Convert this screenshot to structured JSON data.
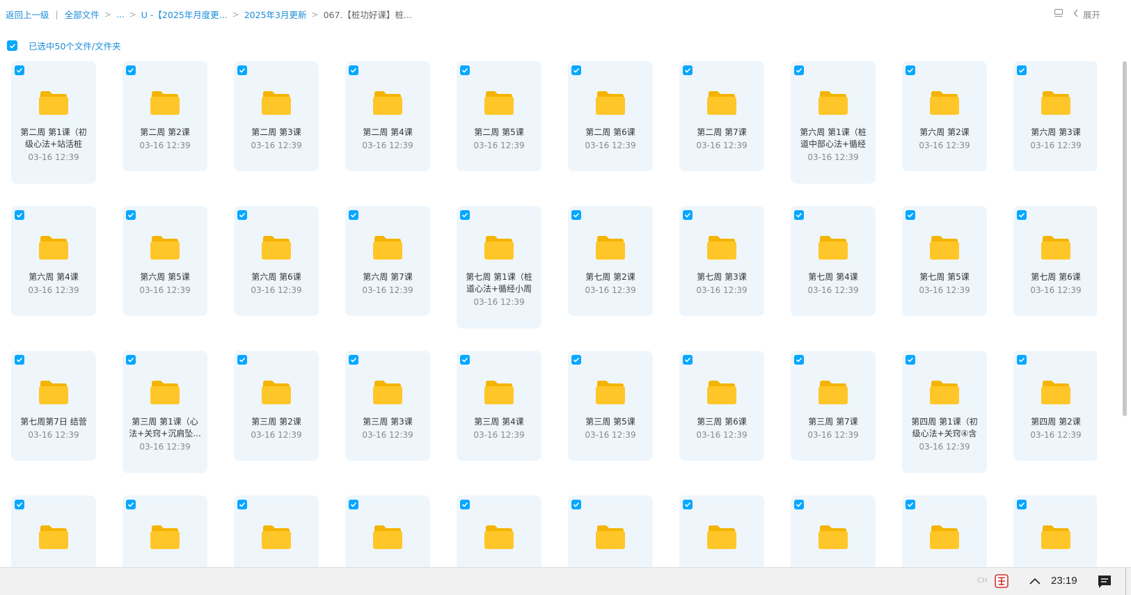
{
  "breadcrumb": {
    "back": "返回上一级",
    "root": "全部文件",
    "ellipsis": "...",
    "level1": "U -【2025年月度更...",
    "level2": "2025年3月更新",
    "current": "067.【桩功好课】桩..."
  },
  "toolbar": {
    "expand": "展开"
  },
  "selection": {
    "label": "已选中50个文件/文件夹"
  },
  "folders": [
    {
      "name": "第二周 第1课（初级心法+站活桩",
      "date": "03-16 12:39"
    },
    {
      "name": "第二周 第2课",
      "date": "03-16 12:39"
    },
    {
      "name": "第二周 第3课",
      "date": "03-16 12:39"
    },
    {
      "name": "第二周 第4课",
      "date": "03-16 12:39"
    },
    {
      "name": "第二周 第5课",
      "date": "03-16 12:39"
    },
    {
      "name": "第二周 第6课",
      "date": "03-16 12:39"
    },
    {
      "name": "第二周 第7课",
      "date": "03-16 12:39"
    },
    {
      "name": "第六周 第1课（桩道中部心法+循经",
      "date": "03-16 12:39"
    },
    {
      "name": "第六周 第2课",
      "date": "03-16 12:39"
    },
    {
      "name": "第六周 第3课",
      "date": "03-16 12:39"
    },
    {
      "name": "第六周 第4课",
      "date": "03-16 12:39"
    },
    {
      "name": "第六周 第5课",
      "date": "03-16 12:39"
    },
    {
      "name": "第六周 第6课",
      "date": "03-16 12:39"
    },
    {
      "name": "第六周 第7课",
      "date": "03-16 12:39"
    },
    {
      "name": "第七周 第1课（桩道心法+循经小周",
      "date": "03-16 12:39"
    },
    {
      "name": "第七周 第2课",
      "date": "03-16 12:39"
    },
    {
      "name": "第七周 第3课",
      "date": "03-16 12:39"
    },
    {
      "name": "第七周 第4课",
      "date": "03-16 12:39"
    },
    {
      "name": "第七周 第5课",
      "date": "03-16 12:39"
    },
    {
      "name": "第七周 第6课",
      "date": "03-16 12:39"
    },
    {
      "name": "第七周第7日 结营",
      "date": "03-16 12:39"
    },
    {
      "name": "第三周 第1课（心法+关窍+沉肩坠...",
      "date": "03-16 12:39"
    },
    {
      "name": "第三周 第2课",
      "date": "03-16 12:39"
    },
    {
      "name": "第三周 第3课",
      "date": "03-16 12:39"
    },
    {
      "name": "第三周 第4课",
      "date": "03-16 12:39"
    },
    {
      "name": "第三周 第5课",
      "date": "03-16 12:39"
    },
    {
      "name": "第三周 第6课",
      "date": "03-16 12:39"
    },
    {
      "name": "第三周 第7课",
      "date": "03-16 12:39"
    },
    {
      "name": "第四周 第1课（初级心法+关窍④含",
      "date": "03-16 12:39"
    },
    {
      "name": "第四周 第2课",
      "date": "03-16 12:39"
    },
    {
      "name": "",
      "date": ""
    },
    {
      "name": "",
      "date": ""
    },
    {
      "name": "",
      "date": ""
    },
    {
      "name": "",
      "date": ""
    },
    {
      "name": "",
      "date": ""
    },
    {
      "name": "",
      "date": ""
    },
    {
      "name": "",
      "date": ""
    },
    {
      "name": "",
      "date": ""
    },
    {
      "name": "",
      "date": ""
    },
    {
      "name": "",
      "date": ""
    }
  ],
  "taskbar": {
    "ime": "CH",
    "clock": "23:19"
  },
  "colors": {
    "accent": "#06a7ff",
    "link": "#1a8cd8",
    "card_bg": "#eef6fc",
    "folder": "#ffc629"
  }
}
